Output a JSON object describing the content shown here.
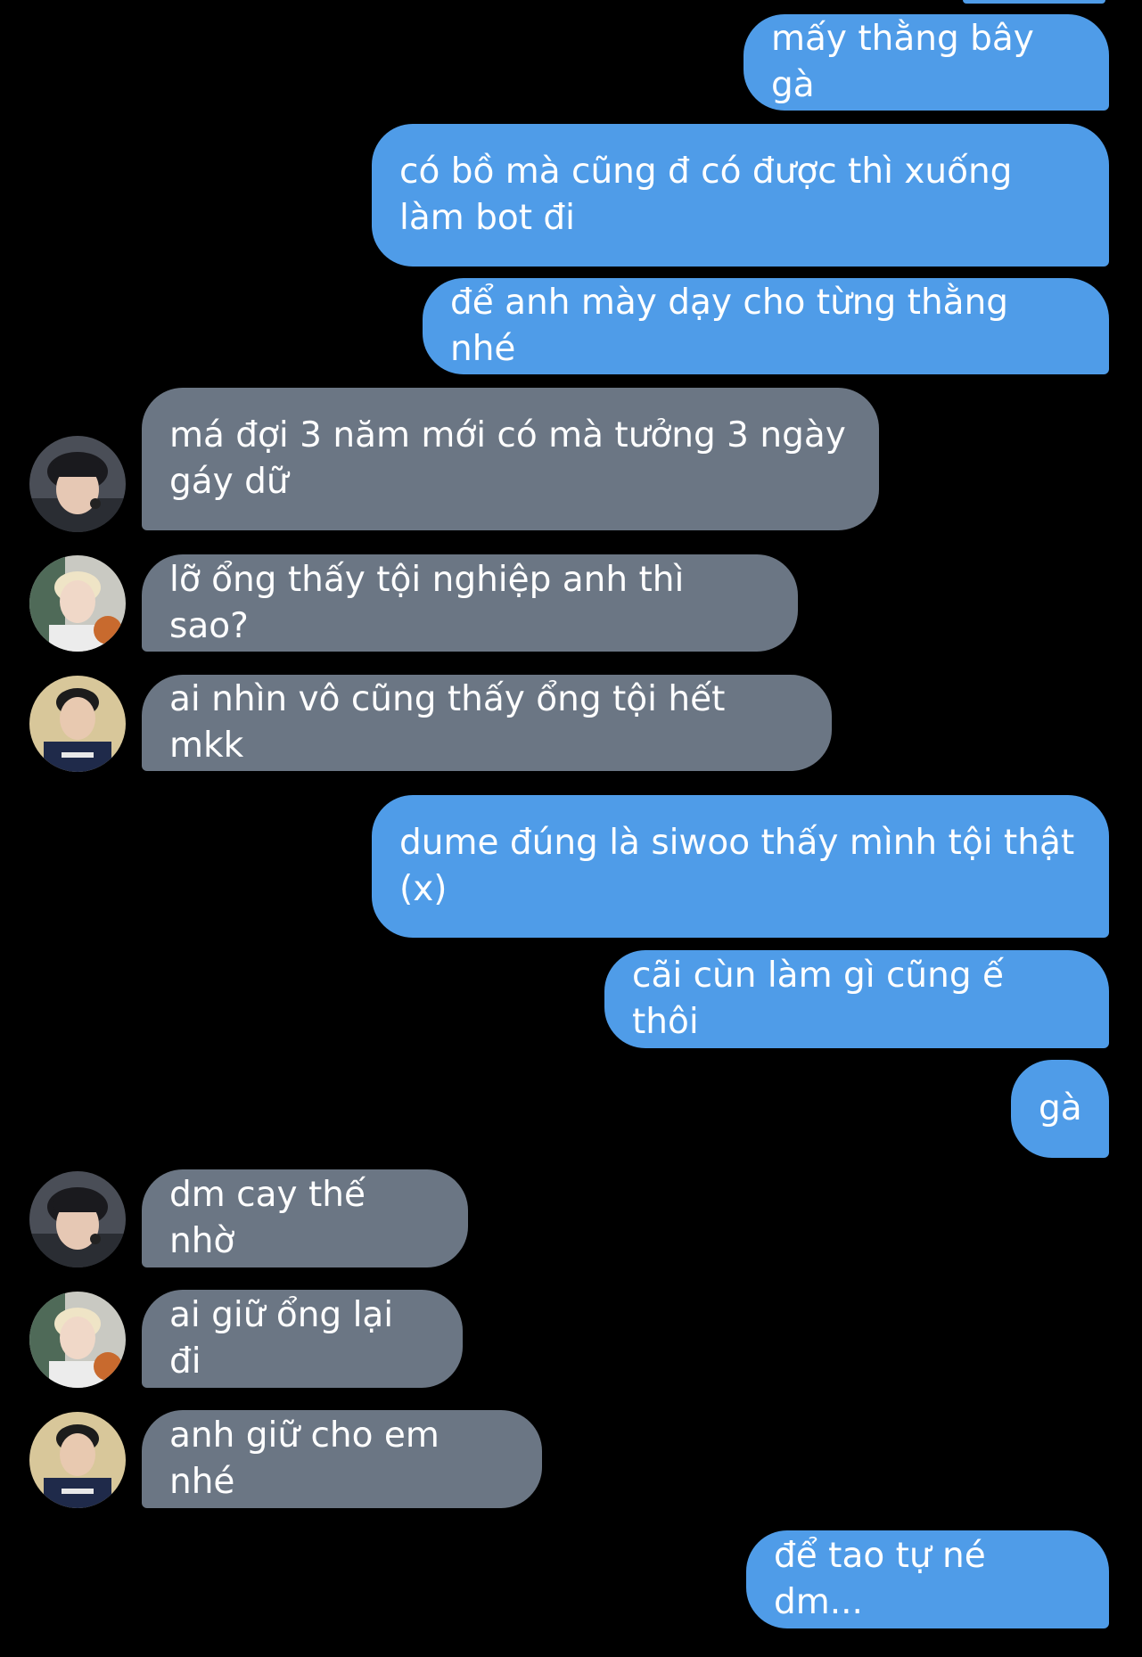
{
  "colors": {
    "outgoing": "#4f9ce8",
    "incoming": "#6b7684",
    "background": "#000000"
  },
  "messages": [
    {
      "side": "out",
      "text": "mấy thằng bây gà"
    },
    {
      "side": "out",
      "text": "có bồ mà cũng đ có được thì xuống làm bot đi"
    },
    {
      "side": "out",
      "text": "để anh mày dạy cho từng thằng nhé"
    },
    {
      "side": "in",
      "avatar": "avatar-1",
      "text": "má đợi 3 năm mới có mà tưởng 3 ngày gáy dữ"
    },
    {
      "side": "in",
      "avatar": "avatar-2",
      "text": "lỡ ổng thấy tội nghiệp anh thì sao?"
    },
    {
      "side": "in",
      "avatar": "avatar-3",
      "text": "ai nhìn vô cũng thấy ổng tội hết mkk"
    },
    {
      "side": "out",
      "text": "dume đúng là siwoo thấy mình tội thật (x)"
    },
    {
      "side": "out",
      "text": "cãi cùn làm gì cũng ế thôi"
    },
    {
      "side": "out",
      "text": "gà"
    },
    {
      "side": "in",
      "avatar": "avatar-1",
      "text": "dm cay thế nhờ"
    },
    {
      "side": "in",
      "avatar": "avatar-2",
      "text": "ai giữ ổng lại đi"
    },
    {
      "side": "in",
      "avatar": "avatar-3",
      "text": "anh giữ cho em nhé"
    },
    {
      "side": "out",
      "text": "để tao tự né dm..."
    }
  ]
}
